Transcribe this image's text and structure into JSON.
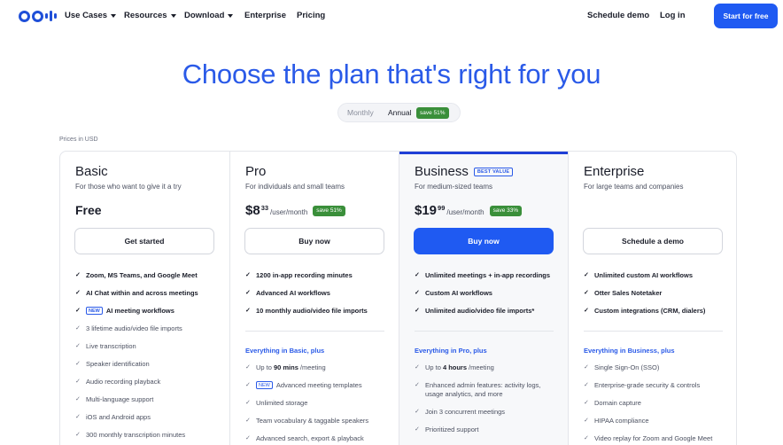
{
  "nav": {
    "items": [
      {
        "label": "Use Cases",
        "dropdown": true
      },
      {
        "label": "Resources",
        "dropdown": true
      },
      {
        "label": "Download",
        "dropdown": true
      },
      {
        "label": "Enterprise",
        "dropdown": false
      },
      {
        "label": "Pricing",
        "dropdown": false
      }
    ],
    "schedule_demo": "Schedule demo",
    "login": "Log in",
    "cta": "Start for free"
  },
  "hero": {
    "title": "Choose the plan that's right for you"
  },
  "billing": {
    "monthly": "Monthly",
    "annual": "Annual",
    "badge": "save 51%",
    "selected": "Annual"
  },
  "currency_note": "Prices in USD",
  "colors": {
    "primary": "#1f5af2",
    "heading": "#2a5ae8",
    "save_badge": "#3a8f3a"
  },
  "plans": [
    {
      "name": "Basic",
      "desc": "For those who want to give it a try",
      "price_text": "Free",
      "button": "Get started",
      "features": [
        {
          "text": "Zoom, MS Teams, and Google Meet"
        },
        {
          "text": "AI Chat within and across meetings"
        },
        {
          "tag": "NEW",
          "text": "AI meeting workflows"
        }
      ],
      "extra": [
        "3 lifetime audio/video file imports",
        "Live transcription",
        "Speaker identification",
        "Audio recording playback",
        "Multi-language support",
        "iOS and Android apps",
        "300 monthly transcription minutes"
      ]
    },
    {
      "name": "Pro",
      "desc": "For individuals and small teams",
      "price_main": "$8",
      "price_cents": "33",
      "price_unit": "/user/month",
      "badge": "save 51%",
      "button": "Buy now",
      "features": [
        {
          "text": "1200 in-app recording minutes"
        },
        {
          "text": "Advanced AI workflows"
        },
        {
          "text": "10 monthly audio/video file imports"
        }
      ],
      "plus_heading": "Everything in Basic, plus",
      "extra": [
        {
          "pre": "Up to",
          "bold": "90 mins",
          "post": "/meeting"
        },
        {
          "tag": "NEW",
          "text": "Advanced meeting templates"
        },
        {
          "text": "Unlimited storage"
        },
        {
          "text": "Team vocabulary & taggable speakers"
        },
        {
          "text": "Advanced search, export & playback"
        }
      ]
    },
    {
      "name": "Business",
      "best_value": "BEST VALUE",
      "desc": "For medium-sized teams",
      "price_main": "$19",
      "price_cents": "99",
      "price_unit": "/user/month",
      "badge": "save 33%",
      "button": "Buy now",
      "features": [
        {
          "text": "Unlimited meetings + in-app recordings"
        },
        {
          "text": "Custom AI workflows"
        },
        {
          "text": "Unlimited audio/video file imports*"
        }
      ],
      "plus_heading": "Everything in Pro, plus",
      "extra": [
        {
          "pre": "Up to",
          "bold": "4 hours",
          "post": "/meeting"
        },
        {
          "text": "Enhanced admin features: activity logs, usage analytics, and more",
          "tall": true
        },
        {
          "text": "Join 3 concurrent meetings"
        },
        {
          "text": "Prioritized support"
        }
      ]
    },
    {
      "name": "Enterprise",
      "desc": "For large teams and companies",
      "button": "Schedule a demo",
      "features": [
        {
          "text": "Unlimited custom AI workflows"
        },
        {
          "text": "Otter Sales Notetaker"
        },
        {
          "text": "Custom integrations (CRM, dialers)"
        }
      ],
      "plus_heading": "Everything in Business, plus",
      "extra": [
        "Single Sign-On (SSO)",
        "Enterprise-grade security & controls",
        "Domain capture",
        "HIPAA compliance",
        "Video replay for Zoom and Google Meet"
      ]
    }
  ]
}
